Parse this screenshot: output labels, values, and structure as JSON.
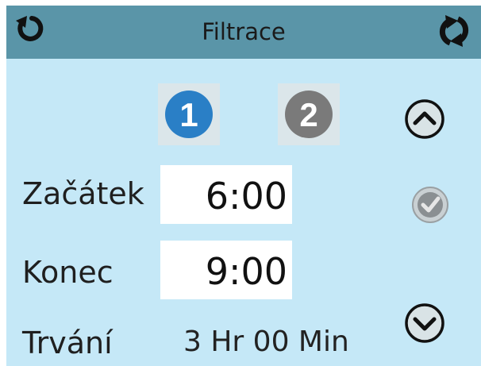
{
  "header": {
    "title": "Filtrace",
    "back_icon": "back-icon",
    "refresh_icon": "refresh-icon",
    "background": "#5a95a8"
  },
  "cycles": {
    "items": [
      {
        "label": "1",
        "state": "selected",
        "color": "#2a7fc6"
      },
      {
        "label": "2",
        "state": "unselected",
        "color": "#7a7a7a"
      }
    ]
  },
  "fields": {
    "start_label": "Začátek",
    "start_value": "6:00",
    "end_label": "Konec",
    "end_value": "9:00",
    "duration_label": "Trvání",
    "duration_value": "3 Hr 00 Min"
  },
  "controls": {
    "up_icon": "chevron-up-icon",
    "confirm_icon": "check-icon",
    "down_icon": "chevron-down-icon"
  },
  "colors": {
    "screen_background": "#c5e8f7",
    "accent": "#2a7fc6"
  }
}
